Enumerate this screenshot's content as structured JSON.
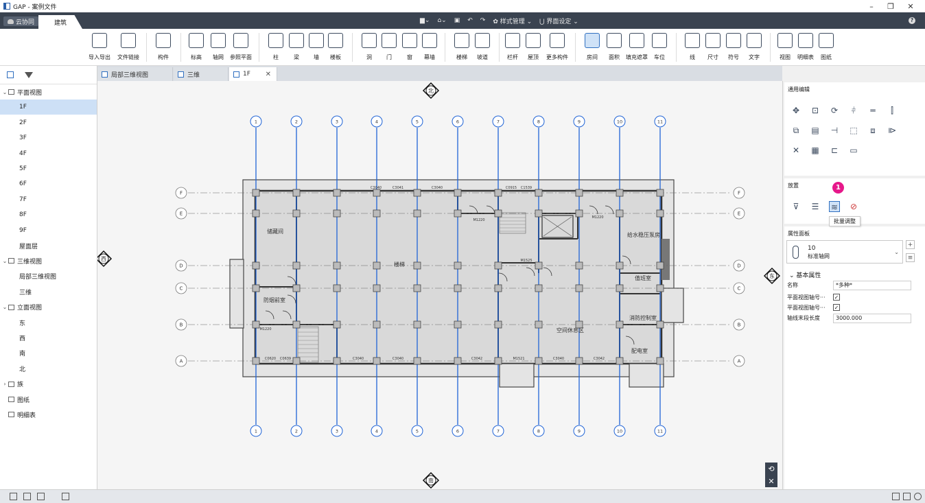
{
  "window": {
    "title": "GAP - 案例文件"
  },
  "menubar": {
    "tab_cloud": "云协同",
    "tab_active": "建筑",
    "quick_tools": [
      "样式管理",
      "界面设定"
    ]
  },
  "ribbon": {
    "buttons": [
      "导入导出",
      "文件链接",
      "构件",
      "标高",
      "轴网",
      "参照平面",
      "柱",
      "梁",
      "墙",
      "楼板",
      "洞",
      "门",
      "窗",
      "幕墙",
      "楼梯",
      "坡道",
      "栏杆",
      "屋顶",
      "更多构件",
      "房间",
      "面积",
      "填充遮罩",
      "车位",
      "线",
      "尺寸",
      "符号",
      "文字",
      "视图",
      "明细表",
      "图纸"
    ],
    "selected": "房间"
  },
  "tree": {
    "items": [
      {
        "label": "平面视图",
        "level": 0,
        "expanded": true,
        "folder": true
      },
      {
        "label": "1F",
        "level": 1,
        "selected": true
      },
      {
        "label": "2F",
        "level": 1
      },
      {
        "label": "3F",
        "level": 1
      },
      {
        "label": "4F",
        "level": 1
      },
      {
        "label": "5F",
        "level": 1
      },
      {
        "label": "6F",
        "level": 1
      },
      {
        "label": "7F",
        "level": 1
      },
      {
        "label": "8F",
        "level": 1
      },
      {
        "label": "9F",
        "level": 1
      },
      {
        "label": "屋面层",
        "level": 1
      },
      {
        "label": "三维视图",
        "level": 0,
        "expanded": true,
        "folder": true
      },
      {
        "label": "局部三维视图",
        "level": 1
      },
      {
        "label": "三维",
        "level": 1
      },
      {
        "label": "立面视图",
        "level": 0,
        "expanded": true,
        "folder": true
      },
      {
        "label": "东",
        "level": 1
      },
      {
        "label": "西",
        "level": 1
      },
      {
        "label": "南",
        "level": 1
      },
      {
        "label": "北",
        "level": 1
      },
      {
        "label": "族",
        "level": 0,
        "expanded": false,
        "folder": true
      },
      {
        "label": "图纸",
        "level": 0,
        "folder": true
      },
      {
        "label": "明细表",
        "level": 0,
        "folder": true
      }
    ]
  },
  "doctabs": [
    {
      "label": "局部三维视图",
      "active": false
    },
    {
      "label": "三维",
      "active": false
    },
    {
      "label": "1F",
      "active": true
    }
  ],
  "plan": {
    "compass": {
      "north": "北",
      "south": "南",
      "west": "西",
      "east": "东"
    },
    "grid_cols": [
      "1",
      "2",
      "3",
      "4",
      "5",
      "6",
      "7",
      "8",
      "9",
      "10",
      "11"
    ],
    "grid_rows": [
      "F",
      "E",
      "D",
      "C",
      "B",
      "A"
    ],
    "rooms": [
      "储藏间",
      "防烟前室",
      "楼梯",
      "值班室",
      "消防控制室",
      "配电室",
      "给水稳压泵房",
      "空间休息区"
    ],
    "door_tags_top": [
      "C3040",
      "C3041",
      "C3040",
      "C0915",
      "C1539"
    ],
    "door_tags_bottom": [
      "C0620",
      "C0639",
      "C3040",
      "C3040",
      "C3042",
      "M1521",
      "C3040",
      "C3042"
    ],
    "door_tags_mid": [
      "M1220",
      "M1220",
      "M1525",
      "M1220"
    ]
  },
  "rightpanel": {
    "edit_title": "通用编辑",
    "place_title": "放置",
    "tooltip": "批量调整",
    "badge": "1",
    "props_title": "属性面板",
    "type_name": "10",
    "type_family": "标准轴网",
    "section": "基本属性",
    "props": [
      {
        "label": "名称",
        "value": "*多种*"
      },
      {
        "label": "平面视图轴号···",
        "checked": true
      },
      {
        "label": "平面视图轴号···",
        "checked": true
      },
      {
        "label": "轴线末段长度",
        "value": "3000.000"
      }
    ]
  }
}
